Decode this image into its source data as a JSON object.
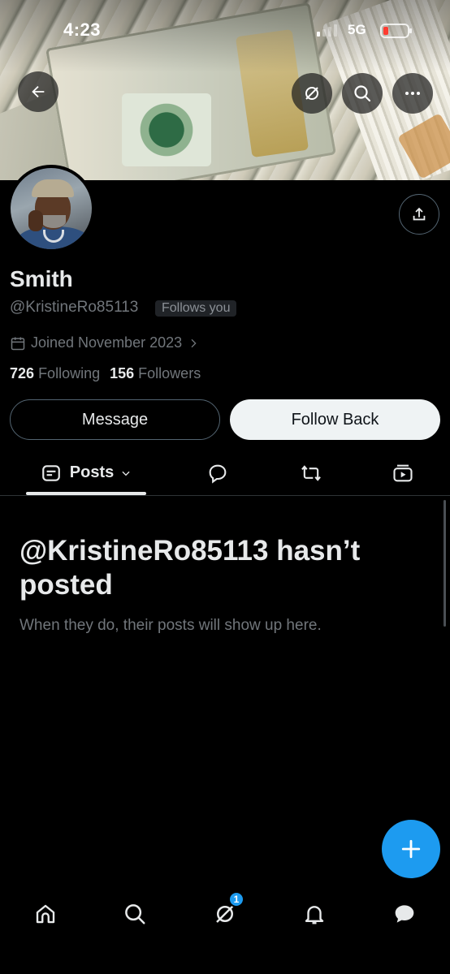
{
  "status_bar": {
    "time": "4:23",
    "network": "5G",
    "battery_level": 0.2,
    "battery_color": "#ff3b30"
  },
  "header": {
    "back_icon": "arrow-left-icon",
    "grok_icon": "grok-slash-circle-icon",
    "search_icon": "search-icon",
    "more_icon": "more-horizontal-icon"
  },
  "profile": {
    "name": "Smith",
    "handle": "@KristineRo85113",
    "follows_you": "Follows you",
    "joined": "Joined November 2023",
    "following_count": "726",
    "following_label": "Following",
    "followers_count": "156",
    "followers_label": "Followers"
  },
  "actions": {
    "message_label": "Message",
    "follow_label": "Follow Back"
  },
  "tabs": {
    "posts_label": "Posts",
    "replies_icon": "reply-bubble-icon",
    "reposts_icon": "repost-icon",
    "media_icon": "media-icon"
  },
  "empty_state": {
    "title": "@KristineRo85113 hasn’t posted",
    "subtitle": "When they do, their posts will show up here."
  },
  "bottom_nav": {
    "grok_badge": "1",
    "items": [
      "home-icon",
      "search-icon",
      "grok-icon",
      "notifications-icon",
      "messages-icon"
    ]
  },
  "colors": {
    "accent": "#1d9bf0",
    "background": "#000000",
    "text_primary": "#e7e9ea",
    "text_secondary": "#71767b"
  }
}
